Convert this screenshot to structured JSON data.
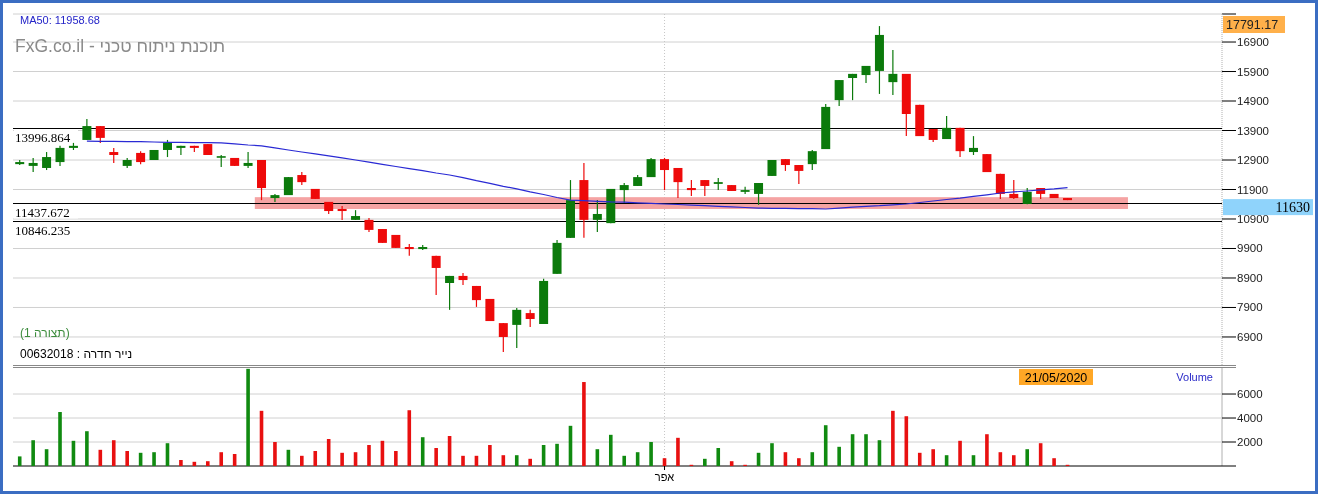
{
  "indicator_label": "MA50: 11958.68",
  "chart_title": "FxG.co.il - תוכנת ניתוח טכני",
  "pattern_label": "(תצורה 1)",
  "security_label": "נייר חדרה : 00632018",
  "price_chart": {
    "chart_data": {
      "type": "candlestick",
      "grid": true,
      "categories": [
        null,
        null,
        null,
        null,
        null,
        null,
        null,
        null,
        null,
        null,
        null,
        null,
        null,
        null,
        null,
        null,
        null,
        null,
        null,
        null,
        null,
        null,
        null,
        null,
        null,
        null,
        null,
        null,
        null,
        null,
        null,
        null,
        null,
        null,
        null,
        null,
        null,
        null,
        null,
        null,
        null,
        null,
        null,
        null,
        null,
        null,
        null,
        null,
        null,
        null,
        null,
        null,
        null,
        null,
        null,
        null,
        null,
        null,
        null,
        null,
        null,
        null,
        null,
        null,
        null,
        null,
        null,
        null,
        null,
        null,
        null,
        null,
        null,
        null,
        null,
        null,
        null,
        null,
        null,
        null,
        null,
        null,
        null,
        null,
        null,
        null,
        null,
        null,
        null,
        null
      ],
      "ylim": [
        5950,
        17850
      ],
      "yticks": [
        6900,
        7900,
        8900,
        9900,
        10900,
        11900,
        12900,
        13900,
        14900,
        15900,
        16900
      ],
      "series": [
        {
          "type": "line",
          "color": "#2a2ad4",
          "values": [
            null,
            null,
            null,
            null,
            null,
            13540,
            13530,
            13530,
            13520,
            13520,
            13510,
            13500,
            13500,
            13490,
            13490,
            13480,
            13450,
            13410,
            13380,
            13310,
            13240,
            13170,
            13110,
            13040,
            12970,
            12900,
            12830,
            12750,
            12680,
            12610,
            12540,
            12460,
            12390,
            12300,
            12200,
            12110,
            12010,
            11920,
            11820,
            11730,
            11630,
            11540,
            11520,
            11500,
            11480,
            11470,
            11450,
            11430,
            11410,
            11390,
            11370,
            11350,
            11330,
            11310,
            11290,
            11270,
            11260,
            11260,
            11250,
            11250,
            11240,
            11270,
            11300,
            11330,
            11350,
            11380,
            11410,
            11460,
            11510,
            11560,
            11610,
            11670,
            11720,
            11780,
            11820,
            11850,
            11890,
            11920,
            11960,
            null,
            null,
            null,
            null,
            null,
            null,
            null,
            null,
            null,
            null,
            null
          ]
        }
      ],
      "ohlc": [
        [
          12760,
          12900,
          12730,
          12830
        ],
        [
          12700,
          12970,
          12490,
          12800
        ],
        [
          12630,
          13170,
          12560,
          13000
        ],
        [
          12830,
          13380,
          12700,
          13310
        ],
        [
          13310,
          13480,
          13240,
          13380
        ],
        [
          13580,
          14290,
          13580,
          14050
        ],
        [
          14050,
          14050,
          13480,
          13650
        ],
        [
          13170,
          13310,
          12800,
          13070
        ],
        [
          12700,
          12970,
          12630,
          12900
        ],
        [
          13140,
          13200,
          12760,
          12830
        ],
        [
          12900,
          13240,
          12900,
          13240
        ],
        [
          13240,
          13580,
          13000,
          13480
        ],
        [
          13310,
          13380,
          13070,
          13380
        ],
        [
          13380,
          13380,
          13170,
          13310
        ],
        [
          13440,
          13440,
          13070,
          13070
        ],
        [
          13000,
          13070,
          12660,
          13030
        ],
        [
          12970,
          12970,
          12700,
          12700
        ],
        [
          12700,
          13170,
          12630,
          12800
        ],
        [
          12900,
          12900,
          11540,
          11950
        ],
        [
          11610,
          11750,
          11480,
          11710
        ],
        [
          11710,
          12320,
          11710,
          12320
        ],
        [
          12390,
          12490,
          12050,
          12150
        ],
        [
          11920,
          11920,
          11580,
          11580
        ],
        [
          11480,
          11480,
          11070,
          11170
        ],
        [
          11240,
          11340,
          10870,
          11170
        ],
        [
          10870,
          11200,
          10870,
          11000
        ],
        [
          10870,
          10930,
          10460,
          10530
        ],
        [
          10560,
          10560,
          10090,
          10090
        ],
        [
          10360,
          10360,
          9920,
          9920
        ],
        [
          9950,
          10050,
          9650,
          9880
        ],
        [
          9880,
          10020,
          9850,
          9950
        ],
        [
          9650,
          9650,
          8320,
          9240
        ],
        [
          8730,
          8970,
          7820,
          8970
        ],
        [
          8970,
          9070,
          8660,
          8830
        ],
        [
          8630,
          8630,
          7920,
          8150
        ],
        [
          8190,
          8190,
          7440,
          7440
        ],
        [
          7370,
          7370,
          6390,
          6900
        ],
        [
          7310,
          7880,
          6530,
          7820
        ],
        [
          7710,
          7820,
          7240,
          7510
        ],
        [
          7340,
          8870,
          7340,
          8800
        ],
        [
          9040,
          10190,
          9040,
          10090
        ],
        [
          10260,
          12220,
          10260,
          11540
        ],
        [
          12220,
          12800,
          10260,
          10870
        ],
        [
          10870,
          11540,
          10460,
          11070
        ],
        [
          10760,
          11920,
          10760,
          11920
        ],
        [
          11880,
          12120,
          11440,
          12050
        ],
        [
          12020,
          12390,
          12020,
          12320
        ],
        [
          12320,
          12970,
          12320,
          12930
        ],
        [
          12930,
          12970,
          11880,
          12560
        ],
        [
          12630,
          12630,
          11610,
          12150
        ],
        [
          11950,
          12220,
          11680,
          11880
        ],
        [
          12220,
          12220,
          11680,
          12020
        ],
        [
          12090,
          12290,
          11880,
          12150
        ],
        [
          12050,
          12050,
          11850,
          11850
        ],
        [
          11820,
          11990,
          11750,
          11880
        ],
        [
          11750,
          12120,
          11380,
          12120
        ],
        [
          12360,
          12900,
          12360,
          12900
        ],
        [
          12930,
          12930,
          12530,
          12730
        ],
        [
          12730,
          12730,
          12090,
          12530
        ],
        [
          12760,
          13240,
          12560,
          13200
        ],
        [
          13270,
          14800,
          13270,
          14700
        ],
        [
          14930,
          15610,
          14730,
          15610
        ],
        [
          15680,
          15820,
          14930,
          15820
        ],
        [
          15780,
          16090,
          15510,
          16090
        ],
        [
          15920,
          17440,
          15140,
          17140
        ],
        [
          15540,
          16630,
          15100,
          15820
        ],
        [
          15820,
          15820,
          13710,
          14460
        ],
        [
          14770,
          14770,
          13710,
          13710
        ],
        [
          13950,
          13950,
          13510,
          13580
        ],
        [
          13610,
          14390,
          13610,
          13990
        ],
        [
          13990,
          13990,
          13000,
          13200
        ],
        [
          13170,
          13710,
          13070,
          13310
        ],
        [
          13100,
          13100,
          12490,
          12490
        ],
        [
          12430,
          12430,
          11580,
          11750
        ],
        [
          11750,
          12220,
          11580,
          11610
        ],
        [
          11410,
          11950,
          11400,
          11820
        ],
        [
          11950,
          11950,
          11580,
          11750
        ],
        [
          11750,
          11750,
          11610,
          11610
        ],
        [
          11610,
          11610,
          11540,
          11540
        ],
        null,
        null,
        null,
        null,
        null,
        null,
        null,
        null,
        null,
        null,
        null
      ],
      "bands": [
        {
          "axis": "y",
          "from": 11240,
          "to": 11640,
          "color": "#f5a3a3"
        }
      ],
      "ref_lines": [
        {
          "axis": "y",
          "value": 13996.864,
          "label": "13996.864"
        },
        {
          "axis": "y",
          "value": 11437.672,
          "label": "11437.672"
        },
        {
          "axis": "y",
          "value": 10846.235,
          "label": "10846.235"
        }
      ],
      "annotations": [
        "17791.17",
        "11630"
      ]
    }
  },
  "volume_chart": {
    "date_label": "21/05/2020",
    "chart_data": {
      "type": "bar",
      "grid": true,
      "stacked": true,
      "title": "Volume",
      "categories": [
        null,
        null,
        null,
        null,
        null,
        null,
        null,
        null,
        null,
        null,
        null,
        null,
        null,
        null,
        null,
        null,
        null,
        null,
        null,
        null,
        null,
        null,
        null,
        null,
        null,
        null,
        null,
        null,
        null,
        null,
        null,
        null,
        null,
        null,
        null,
        null,
        null,
        null,
        null,
        null,
        null,
        null,
        null,
        null,
        null,
        null,
        null,
        null,
        "אפר",
        null,
        null,
        null,
        null,
        null,
        null,
        null,
        null,
        null,
        null,
        null,
        null,
        null,
        null,
        null,
        null,
        null,
        null,
        null,
        null,
        null,
        null,
        null,
        null,
        null,
        null,
        null,
        null,
        null,
        null,
        null,
        null,
        null,
        null,
        null,
        null,
        null,
        null,
        null,
        null,
        null
      ],
      "ylim": [
        0,
        8170
      ],
      "yticks": [
        2000,
        4000,
        6000
      ],
      "series": [
        {
          "color": "#108a10",
          "values": [
            800,
            2150,
            1400,
            4500,
            2100,
            2900,
            null,
            null,
            null,
            1100,
            1150,
            1900,
            null,
            null,
            null,
            null,
            null,
            8100,
            null,
            null,
            1350,
            null,
            null,
            null,
            null,
            null,
            null,
            null,
            null,
            null,
            2400,
            null,
            null,
            null,
            null,
            null,
            null,
            900,
            null,
            1750,
            1850,
            3350,
            null,
            1400,
            2600,
            850,
            1150,
            2000,
            null,
            null,
            null,
            600,
            1500,
            null,
            null,
            1100,
            1900,
            null,
            null,
            1150,
            3400,
            1600,
            2650,
            2650,
            2150,
            null,
            null,
            null,
            null,
            900,
            null,
            900,
            null,
            null,
            null,
            1400,
            null,
            null,
            null,
            null,
            null,
            null,
            null,
            null,
            null,
            null,
            null,
            null,
            null,
            null
          ]
        },
        {
          "color": "#e81010",
          "values": [
            null,
            null,
            null,
            null,
            null,
            null,
            1350,
            2150,
            1250,
            null,
            null,
            null,
            500,
            350,
            400,
            1150,
            1000,
            null,
            4600,
            2000,
            null,
            850,
            1250,
            2250,
            1100,
            1150,
            1750,
            2100,
            1250,
            4650,
            null,
            1500,
            2500,
            850,
            850,
            1750,
            900,
            null,
            600,
            null,
            null,
            null,
            7000,
            null,
            null,
            null,
            null,
            null,
            650,
            2350,
            100,
            null,
            null,
            400,
            100,
            null,
            null,
            1150,
            650,
            null,
            null,
            null,
            null,
            null,
            null,
            4600,
            4150,
            1100,
            1400,
            null,
            2100,
            null,
            2650,
            1150,
            900,
            null,
            1900,
            650,
            100,
            null,
            null,
            null,
            null,
            null,
            null,
            null,
            null,
            null,
            null,
            null
          ]
        }
      ]
    }
  }
}
